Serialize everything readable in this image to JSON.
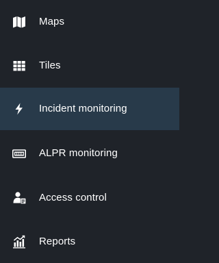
{
  "sidebar": {
    "items": [
      {
        "label": "Maps",
        "icon": "map-icon"
      },
      {
        "label": "Tiles",
        "icon": "tiles-grid-icon"
      },
      {
        "label": "Incident monitoring",
        "icon": "lightning-bolt-icon",
        "active": true
      },
      {
        "label": "ALPR monitoring",
        "icon": "license-plate-icon"
      },
      {
        "label": "Access control",
        "icon": "access-control-icon"
      },
      {
        "label": "Reports",
        "icon": "reports-chart-icon"
      }
    ],
    "colors": {
      "background": "#1f2329",
      "active_background": "#283a4a",
      "text": "#ffffff"
    }
  }
}
